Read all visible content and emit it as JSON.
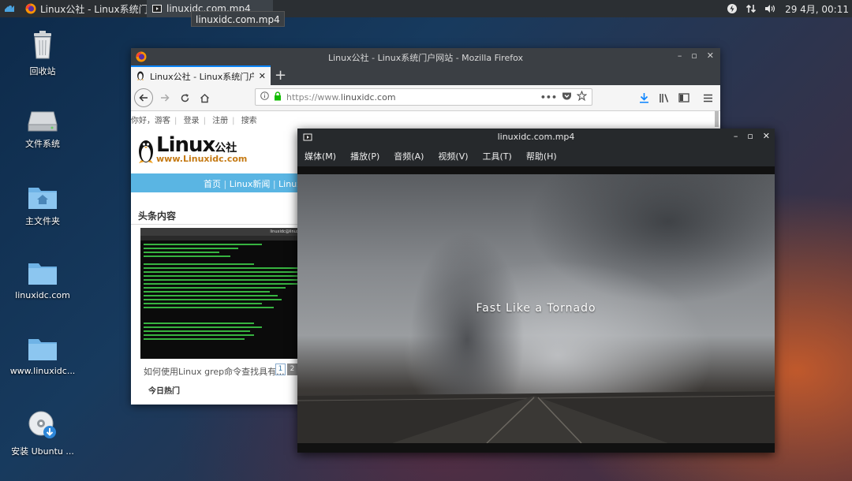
{
  "taskbar": {
    "tasks": [
      {
        "label": "Linux公社 - Linux系统门户..."
      },
      {
        "label": "linuxidc.com.mp4"
      }
    ],
    "tooltip": "linuxidc.com.mp4",
    "clock": "29 4月, 00:11"
  },
  "desktop": {
    "icons": [
      {
        "label": "回收站",
        "icon": "trash-icon"
      },
      {
        "label": "文件系统",
        "icon": "drive-icon"
      },
      {
        "label": "主文件夹",
        "icon": "home-folder-icon"
      },
      {
        "label": "linuxidc.com",
        "icon": "folder-icon"
      },
      {
        "label": "www.linuxidc...",
        "icon": "folder-icon"
      },
      {
        "label": "安装 Ubuntu ...",
        "icon": "install-disc-icon"
      }
    ]
  },
  "firefox": {
    "title": "Linux公社 - Linux系统门户网站 - Mozilla Firefox",
    "tab_label": "Linux公社 - Linux系统门户网",
    "url_prefix": "https://www.",
    "url_domain": "linuxidc.com",
    "page": {
      "top_links": [
        "你好，游客",
        "登录",
        "注册",
        "搜索"
      ],
      "logo_text": "Linux",
      "logo_suffix": "公社",
      "logo_url": "www.Linuxidc.com",
      "nav_links": [
        "首页",
        "Linux新闻",
        "Linux"
      ],
      "section_title": "头条内容",
      "terminal_title": "linuxidc@linuxidc: ~",
      "caption": "如何使用Linux grep命令查找具有...",
      "pager": [
        "1",
        "2"
      ],
      "hot_title": "今日热门"
    }
  },
  "player": {
    "title": "linuxidc.com.mp4",
    "menu": [
      "媒体(M)",
      "播放(P)",
      "音频(A)",
      "视频(V)",
      "工具(T)",
      "帮助(H)"
    ],
    "subtitle": "Fast Like a Tornado"
  },
  "colors": {
    "taskbar": "#2b2f33",
    "firefox_accent": "#0a84ff",
    "site_blue": "#5ab5e3",
    "terminal_green": "#3fd14a",
    "desktop_orange": "#d66028"
  }
}
